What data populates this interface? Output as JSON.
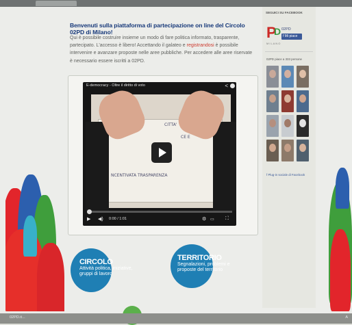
{
  "browser": {
    "tab_label": ""
  },
  "main": {
    "title": "Benvenuti sulla piattaforma di partecipazione on line del Circolo 02PD di Milano!",
    "intro_before_link": "Qui è possibile costruire insieme un modo di fare politica informato, trasparente, partecipato. L'accesso è libero! Accettando il galateo e ",
    "intro_link": "registrandosi",
    "intro_after_link": " è possibile intervenire e avanzare proposte nelle aree pubbliche. Per accedere alle aree riservate è necessario essere iscritti a 02PD."
  },
  "video": {
    "title": "E-democracy - Oltre il diritto di voto",
    "share_icon": "share-icon",
    "info_icon": "info-icon",
    "paper_lines": [
      "CITTA'",
      "CE E",
      "NCENTIVATA TRASPARENZA"
    ],
    "progress": 0.0,
    "time": "0:00 / 1:01",
    "play_icon": "play-icon",
    "volume_icon": "volume-icon",
    "settings_icon": "gear-icon",
    "youtube_icon": "youtube-icon",
    "fullscreen_icon": "fullscreen-icon"
  },
  "circles": [
    {
      "title": "CIRCOLO",
      "subtitle": "Attività politica, iniziative, gruppi di lavoro"
    },
    {
      "title": "TERRITORIO",
      "subtitle": "Segnalazioni, problemi e proposte del territorio"
    }
  ],
  "sidebar": {
    "header": "SEGUICI SU FACEBOOK",
    "page_name": "02PD",
    "logo_p": "P",
    "logo_d": "D",
    "logo_sub": "MILANO",
    "like_label": "Mi piace",
    "fans_label": "02PD piace a 333 persone",
    "plugin_label": "Plug-in sociale di Facebook"
  },
  "status": {
    "left": "02PD.it...",
    "right": "A"
  },
  "colors": {
    "title_blue": "#17397a",
    "link_red": "#cc3a2e",
    "circle_blue": "#1f7fb4",
    "fb_blue": "#3b5998",
    "pd_red": "#cc2a26",
    "pd_green": "#3b9a42"
  }
}
